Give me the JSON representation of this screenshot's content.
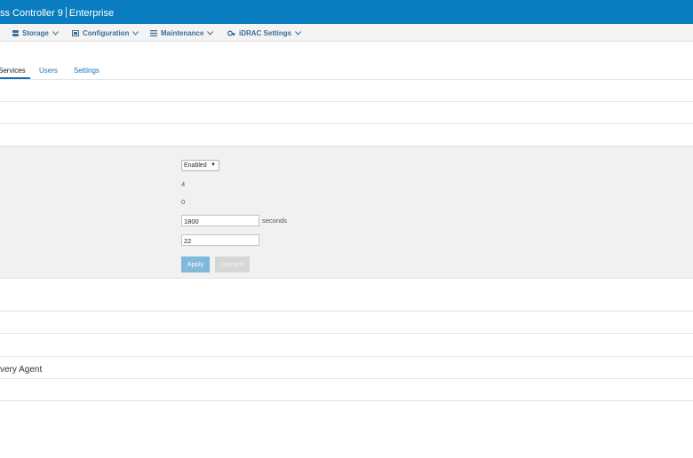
{
  "header": {
    "product": "ss Controller 9",
    "edition": "Enterprise"
  },
  "nav": {
    "storage": "Storage",
    "configuration": "Configuration",
    "maintenance": "Maintenance",
    "idrac_settings": "iDRAC Settings"
  },
  "tabs": [
    {
      "label": "Services",
      "active": true
    },
    {
      "label": "Users",
      "active": false
    },
    {
      "label": "Settings",
      "active": false
    }
  ],
  "form": {
    "enabled_select": "Enabled",
    "value_4": "4",
    "value_0": "0",
    "timeout_value": "1800",
    "timeout_unit": "seconds",
    "port_value": "22",
    "apply_label": "Apply",
    "discard_label": "Discard"
  },
  "sections": {
    "recovery_agent": "very Agent"
  },
  "colors": {
    "header_bg": "#0a7dc0",
    "link": "#1a73ba",
    "apply_button": "#7fb9db",
    "discard_button": "#d6d6d6"
  }
}
